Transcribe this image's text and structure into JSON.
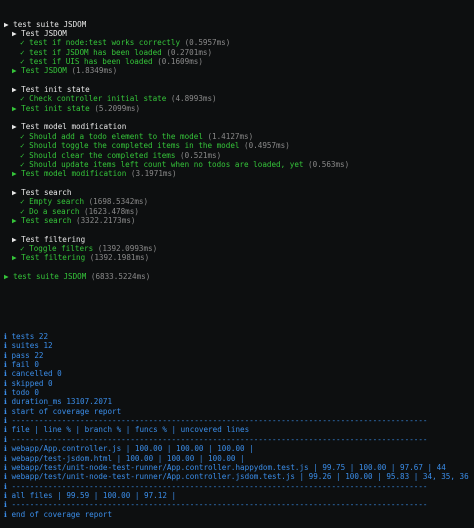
{
  "suites": [
    {
      "lines": [
        {
          "indent": 0,
          "marker": "▶",
          "text": "test suite JSDOM",
          "time": "",
          "color": "w"
        },
        {
          "indent": 1,
          "marker": "▶",
          "text": "Test JSDOM",
          "time": "",
          "color": "w"
        },
        {
          "indent": 2,
          "marker": "✓",
          "text": "test if node:test works correctly",
          "time": "(0.5957ms)",
          "color": "g"
        },
        {
          "indent": 2,
          "marker": "✓",
          "text": "test if JSDOM has been loaded",
          "time": "(0.2701ms)",
          "color": "g"
        },
        {
          "indent": 2,
          "marker": "✓",
          "text": "test if UIS has been loaded",
          "time": "(0.1609ms)",
          "color": "g"
        },
        {
          "indent": 1,
          "marker": "▶",
          "text": "Test JSDOM",
          "time": "(1.8349ms)",
          "color": "g"
        }
      ]
    },
    {
      "lines": [
        {
          "indent": 1,
          "marker": "▶",
          "text": "Test init state",
          "time": "",
          "color": "w"
        },
        {
          "indent": 2,
          "marker": "✓",
          "text": "Check controller initial state",
          "time": "(4.8993ms)",
          "color": "g"
        },
        {
          "indent": 1,
          "marker": "▶",
          "text": "Test init state",
          "time": "(5.2099ms)",
          "color": "g"
        }
      ]
    },
    {
      "lines": [
        {
          "indent": 1,
          "marker": "▶",
          "text": "Test model modification",
          "time": "",
          "color": "w"
        },
        {
          "indent": 2,
          "marker": "✓",
          "text": "Should add a todo element to the model",
          "time": "(1.4127ms)",
          "color": "g"
        },
        {
          "indent": 2,
          "marker": "✓",
          "text": "Should toggle the completed items in the model",
          "time": "(0.4957ms)",
          "color": "g"
        },
        {
          "indent": 2,
          "marker": "✓",
          "text": "Should clear the completed items",
          "time": "(0.521ms)",
          "color": "g"
        },
        {
          "indent": 2,
          "marker": "✓",
          "text": "Should update items left count when no todos are loaded, yet",
          "time": "(0.563ms)",
          "color": "g"
        },
        {
          "indent": 1,
          "marker": "▶",
          "text": "Test model modification",
          "time": "(3.1971ms)",
          "color": "g"
        }
      ]
    },
    {
      "lines": [
        {
          "indent": 1,
          "marker": "▶",
          "text": "Test search",
          "time": "",
          "color": "w"
        },
        {
          "indent": 2,
          "marker": "✓",
          "text": "Empty search",
          "time": "(1698.5342ms)",
          "color": "g"
        },
        {
          "indent": 2,
          "marker": "✓",
          "text": "Do a search",
          "time": "(1623.478ms)",
          "color": "g"
        },
        {
          "indent": 1,
          "marker": "▶",
          "text": "Test search",
          "time": "(3322.2173ms)",
          "color": "g"
        }
      ]
    },
    {
      "lines": [
        {
          "indent": 1,
          "marker": "▶",
          "text": "Test filtering",
          "time": "",
          "color": "w"
        },
        {
          "indent": 2,
          "marker": "✓",
          "text": "Toggle filters",
          "time": "(1392.0993ms)",
          "color": "g"
        },
        {
          "indent": 1,
          "marker": "▶",
          "text": "Test filtering",
          "time": "(1392.1981ms)",
          "color": "g"
        }
      ]
    },
    {
      "lines": [
        {
          "indent": 0,
          "marker": "▶",
          "text": "test suite JSDOM",
          "time": "(6833.5224ms)",
          "color": "g"
        }
      ]
    }
  ],
  "summary": [
    "ℹ tests 22",
    "ℹ suites 12",
    "ℹ pass 22",
    "ℹ fail 0",
    "ℹ cancelled 0",
    "ℹ skipped 0",
    "ℹ todo 0",
    "ℹ duration_ms 13107.2071",
    "ℹ start of coverage report",
    "ℹ -------------------------------------------------------------------------------------------",
    "ℹ file | line % | branch % | funcs % | uncovered lines",
    "ℹ -------------------------------------------------------------------------------------------",
    "ℹ webapp/App.controller.js | 100.00 | 100.00 | 100.00 |",
    "ℹ webapp/test-jsdom.html | 100.00 | 100.00 | 100.00 |",
    "ℹ webapp/test/unit-node-test-runner/App.controller.happydom.test.js | 99.75 | 100.00 | 97.67 | 44",
    "ℹ webapp/test/unit-node-test-runner/App.controller.jsdom.test.js | 99.26 | 100.00 | 95.83 | 34, 35, 36",
    "ℹ -------------------------------------------------------------------------------------------",
    "ℹ all files | 99.59 | 100.00 | 97.12 |",
    "ℹ -------------------------------------------------------------------------------------------",
    "ℹ end of coverage report"
  ]
}
